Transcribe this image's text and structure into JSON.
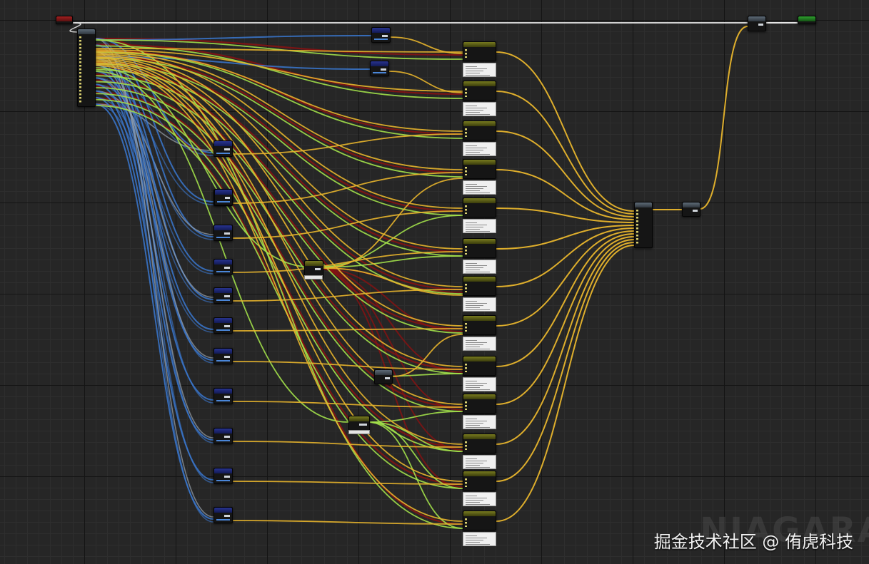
{
  "editor": {
    "watermark": "NIAGARA",
    "site_label": "掘金技术社区 @ 侑虎科技"
  },
  "colors": {
    "background": "#262626",
    "wire_blue": "#3a78d0",
    "wire_gray": "#9aa4ae",
    "wire_yellow": "#e8b52c",
    "wire_green": "#a2e04a",
    "wire_red": "#8a1212",
    "wire_exec": "#e6e6e6",
    "header_blue": "#1f2a7a",
    "header_olive": "#6a6c18",
    "header_gray": "#4d5966",
    "header_entry": "#a22020",
    "header_exit": "#2fa02f"
  },
  "graph": {
    "entry_icon": "red-entry-node",
    "exit_icon": "green-output-node",
    "getter_nodes": 14,
    "function_nodes": 13,
    "helper_nodes": 2
  }
}
